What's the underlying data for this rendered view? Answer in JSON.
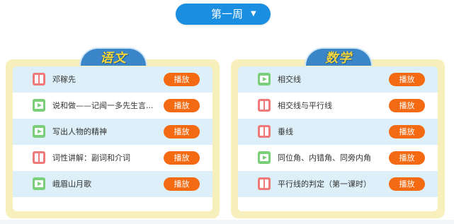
{
  "week_selector": {
    "label": "第一周",
    "caret": "▼"
  },
  "subjects": [
    {
      "name": "语文",
      "lessons": [
        {
          "title": "邓稼先",
          "icon": "book-icon",
          "play": "播放"
        },
        {
          "title": "说和做——记闻一多先生言...",
          "icon": "video-icon",
          "play": "播放"
        },
        {
          "title": "写出人物的精神",
          "icon": "video-icon",
          "play": "播放"
        },
        {
          "title": "词性讲解：副词和介词",
          "icon": "book-icon",
          "play": "播放"
        },
        {
          "title": "峨眉山月歌",
          "icon": "video-icon",
          "play": "播放"
        }
      ]
    },
    {
      "name": "数学",
      "lessons": [
        {
          "title": "相交线",
          "icon": "video-icon",
          "play": "播放"
        },
        {
          "title": "相交线与平行线",
          "icon": "book-icon",
          "play": "播放"
        },
        {
          "title": "垂线",
          "icon": "book-icon",
          "play": "播放"
        },
        {
          "title": "同位角、内错角、同旁内角",
          "icon": "video-icon",
          "play": "播放"
        },
        {
          "title": "平行线的判定（第一课时）",
          "icon": "book-icon",
          "play": "播放"
        }
      ]
    }
  ],
  "colors": {
    "accent_blue": "#1a8ee0",
    "play_orange": "#f36a12",
    "panel_yellow": "#f7f0bd",
    "row_blue": "#ddf0f9"
  }
}
